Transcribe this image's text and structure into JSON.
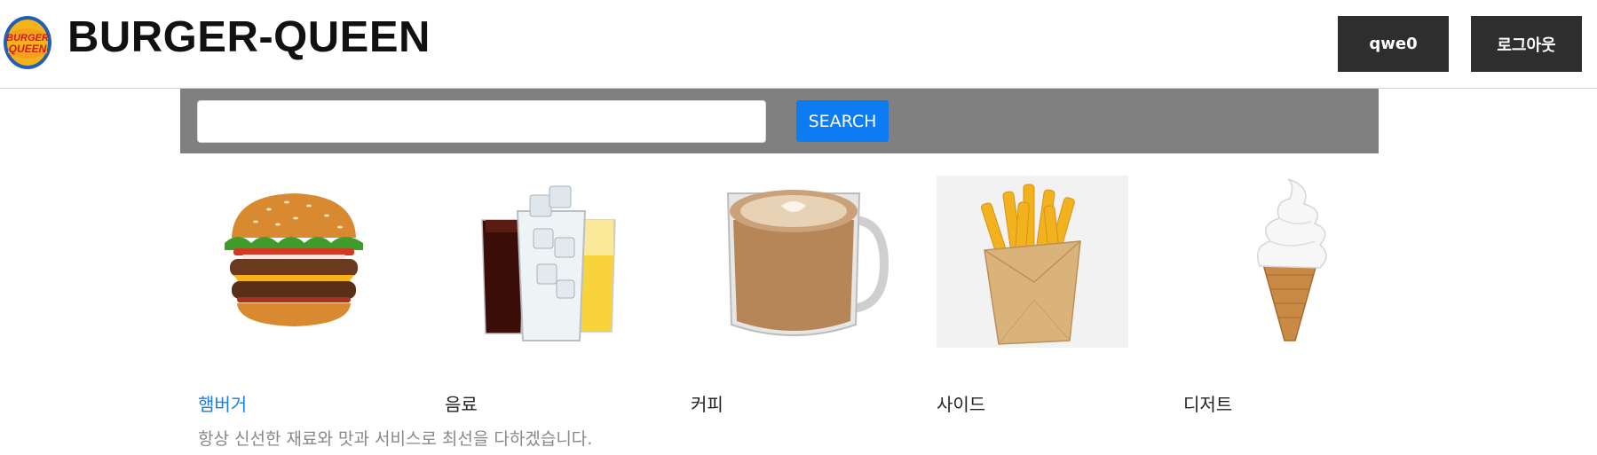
{
  "header": {
    "brand": "BURGER-QUEEN",
    "logo_text_top": "BURGER",
    "logo_text_bottom": "QUEEN",
    "user_button": "qwe0",
    "logout_button": "로그아웃"
  },
  "search": {
    "placeholder": "",
    "value": "",
    "button_label": "SEARCH"
  },
  "menu": {
    "items": [
      {
        "label": "햄버거",
        "icon": "burger-image",
        "active": true
      },
      {
        "label": "음료",
        "icon": "drinks-image",
        "active": false
      },
      {
        "label": "커피",
        "icon": "coffee-image",
        "active": false
      },
      {
        "label": "사이드",
        "icon": "fries-image",
        "active": false
      },
      {
        "label": "디저트",
        "icon": "ice-cream-image",
        "active": false
      }
    ]
  },
  "tagline": "항상 신선한 재료와 맛과 서비스로 최선을 다하겠습니다.",
  "colors": {
    "header_button_bg": "#2e2e2e",
    "searchbar_bg": "#808080",
    "search_button_bg": "#0d7cf2",
    "active_category": "#1a7ee8",
    "tagline": "#888888"
  }
}
